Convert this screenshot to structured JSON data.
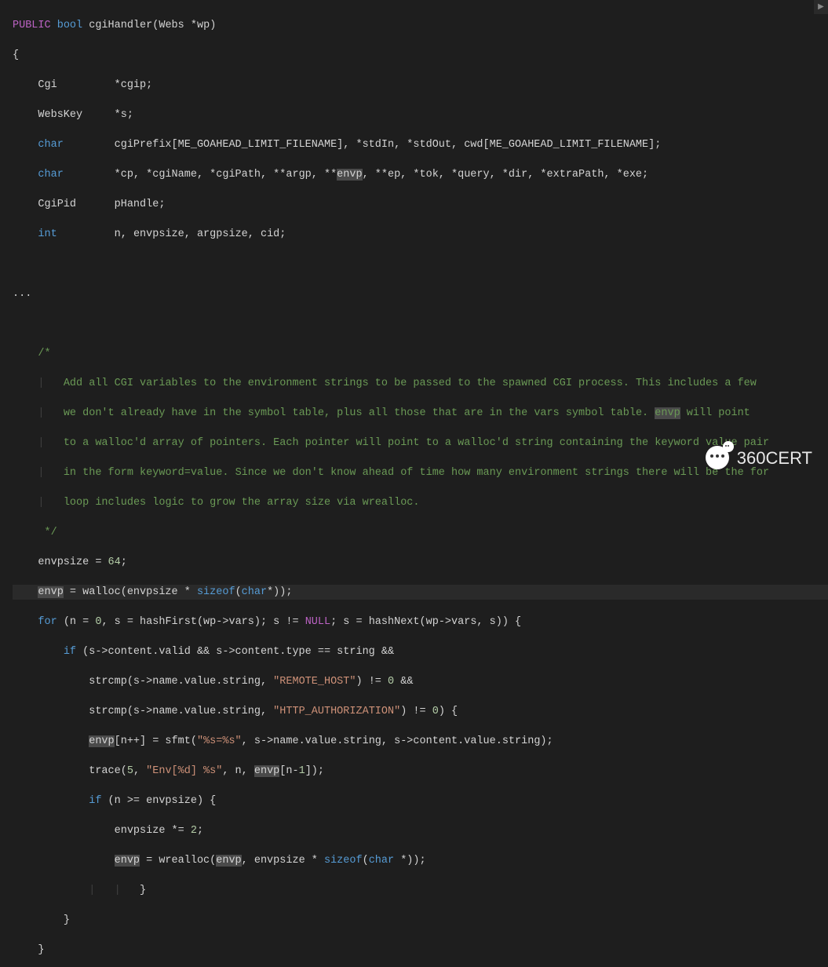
{
  "watermark": "360CERT",
  "ellipsis": "...",
  "code": {
    "sig": {
      "public": "PUBLIC",
      "bool": "bool",
      "fn": "cgiHandler",
      "arg_type": "Webs",
      "arg": "*wp"
    },
    "decl": {
      "cgi": {
        "type": "Cgi",
        "var": "*cgip;"
      },
      "webskey": {
        "type": "WebsKey",
        "var": "*s;"
      },
      "char1": {
        "type": "char",
        "var": "cgiPrefix[ME_GOAHEAD_LIMIT_FILENAME], *stdIn, *stdOut, cwd[ME_GOAHEAD_LIMIT_FILENAME];"
      },
      "char2": {
        "type": "char",
        "var_pre": "*cp, *cgiName, *cgiPath, **argp, **",
        "var_hl": "envp",
        "var_post": ", **ep, *tok, *query, *dir, *extraPath, *exe;"
      },
      "cgipid": {
        "type": "CgiPid",
        "var": "pHandle;"
      },
      "int": {
        "type": "int",
        "var": "n, envpsize, argpsize, cid;"
      }
    },
    "comment": {
      "open": "/*",
      "l1": "Add all CGI variables to the environment strings to be passed to the spawned CGI process. This includes a few",
      "l2a": "we don't already have in the symbol table, plus all those that are in the vars symbol table. ",
      "l2hl": "envp",
      "l2b": " will point",
      "l3": "to a walloc'd array of pointers. Each pointer will point to a walloc'd string containing the keyword value pair",
      "l4": "in the form keyword=value. Since we don't know ahead of time how many environment strings there will be the for",
      "l5": "loop includes logic to grow the array size via wrealloc.",
      "close": " */"
    },
    "body": {
      "envpsize_init": {
        "pre": "envpsize = ",
        "num": "64",
        "post": ";"
      },
      "envp_alloc": {
        "hl": "envp",
        "mid": " = walloc(envpsize * ",
        "sizeof": "sizeof",
        "post1": "(",
        "char": "char",
        "post2": "*));"
      },
      "for": {
        "kw": "for",
        "pre": " (n = ",
        "zero": "0",
        "mid1": ", s = hashFirst(wp->vars); s != ",
        "null": "NULL",
        "mid2": "; s = hashNext(wp->vars, s)) {"
      },
      "if1": {
        "kw": "if",
        "text": " (s->content.valid && s->content.type == string &&"
      },
      "strcmp1": {
        "pre": "strcmp(s->name.value.string, ",
        "str": "\"REMOTE_HOST\"",
        "post": ") != ",
        "zero": "0",
        "tail": " &&"
      },
      "strcmp2": {
        "pre": "strcmp(s->name.value.string, ",
        "str": "\"HTTP_AUTHORIZATION\"",
        "post": ") != ",
        "zero": "0",
        "tail": ") {"
      },
      "sfmt": {
        "hl": "envp",
        "pre": "[n++] = sfmt(",
        "str": "\"%s=%s\"",
        "post": ", s->name.value.string, s->content.value.string);"
      },
      "trace": {
        "pre": "trace(",
        "num": "5",
        "mid": ", ",
        "str": "\"Env[%d] %s\"",
        "post": ", n, ",
        "hl": "envp",
        "tail": "[n-",
        "one": "1",
        "end": "]);"
      },
      "if2": {
        "kw": "if",
        "text": " (n >= envpsize) {"
      },
      "double": {
        "pre": "envpsize *= ",
        "num": "2",
        "post": ";"
      },
      "realloc": {
        "hl1": "envp",
        "mid1": " = wrealloc(",
        "hl2": "envp",
        "mid2": ", envpsize * ",
        "sizeof": "sizeof",
        "post1": "(",
        "char": "char",
        "post2": " *));"
      },
      "brace_close_inner": "}",
      "brace_close_mid": "}",
      "brace_close_outer": "}"
    }
  }
}
